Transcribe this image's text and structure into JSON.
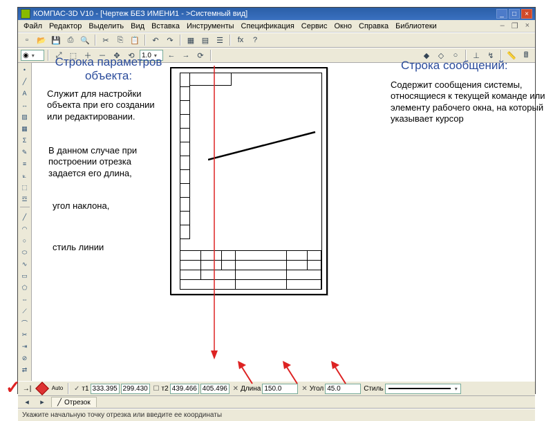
{
  "window": {
    "title": "КОМПАС-3D V10 - [Чертеж БЕЗ ИМЕНИ1 - >Системный вид]",
    "min": "_",
    "max": "□",
    "close": "×",
    "mdi_min": "–",
    "mdi_max": "❐",
    "mdi_close": "×"
  },
  "menu": [
    "Файл",
    "Редактор",
    "Выделить",
    "Вид",
    "Вставка",
    "Инструменты",
    "Спецификация",
    "Сервис",
    "Окно",
    "Справка",
    "Библиотеки"
  ],
  "toolbar2": {
    "zoom": "1.0"
  },
  "param": {
    "pt1_lbl": "т1",
    "pt1_x": "333.395",
    "pt1_y": "299.430",
    "pt2_lbl": "т2",
    "pt2_x": "439.466",
    "pt2_y": "405.496",
    "len_lbl": "Длина",
    "len_val": "150.0",
    "ang_lbl": "Угол",
    "ang_val": "45.0",
    "style_lbl": "Стиль",
    "auto_lbl": "Auto"
  },
  "tab": {
    "label": "Отрезок"
  },
  "status": "Укажите начальную точку отрезка или введите ее координаты",
  "anno": {
    "left_title": "Строка параметров объекта:",
    "left_p1": "Служит для настройки объекта при его создании или редактировании.",
    "left_p2": "В данном случае при построении отрезка задается его длина,",
    "left_p3": "угол наклона,",
    "left_p4": "стиль линии",
    "right_title": "Строка сообщений:",
    "right_p1": "Содержит сообщения системы, относящиеся к текущей команде или элементу рабочего окна, на который  указывает курсор"
  }
}
